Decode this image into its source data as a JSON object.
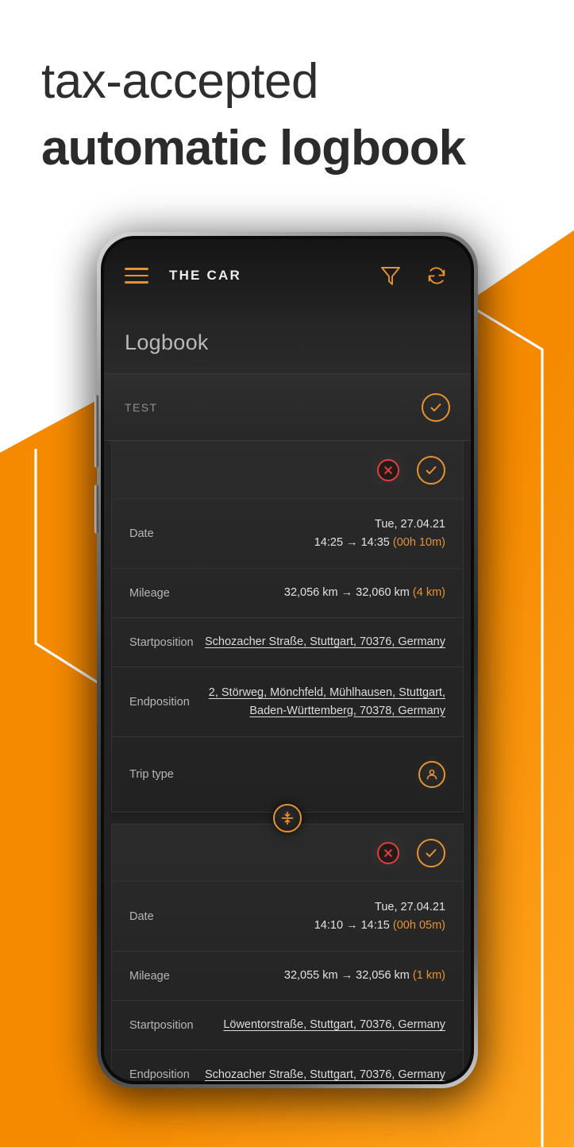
{
  "headline": {
    "line1": "tax-accepted",
    "line2": "automatic logbook"
  },
  "colors": {
    "accent": "#F08A00",
    "accent_ui": "#E8922F",
    "danger": "#E03B3B",
    "screen_bg": "#1F1F1F"
  },
  "app": {
    "appbar": {
      "menu_icon": "hamburger-menu-icon",
      "title": "THE CAR",
      "filter_icon": "filter-funnel-icon",
      "refresh_icon": "refresh-sync-icon"
    },
    "page_title": "Logbook",
    "group": {
      "label": "TEST",
      "accept_icon": "check-circle-icon"
    },
    "labels": {
      "date": "Date",
      "mileage": "Mileage",
      "startposition": "Startposition",
      "endposition": "Endposition",
      "trip_type": "Trip type"
    },
    "merge_icon": "merge-trips-icon",
    "trips": [
      {
        "reject_icon": "reject-circle-icon",
        "accept_icon": "check-circle-icon",
        "date_day": "Tue, 27.04.21",
        "date_times": "14:25 → 14:35",
        "date_duration": "(00h 10m)",
        "mileage_range": "32,056 km → 32,060 km",
        "mileage_delta": "(4 km)",
        "startposition": "Schozacher Straße, Stuttgart, 70376, Germany",
        "endposition_line1": "2, Störweg, Mönchfeld, Mühlhausen, Stuttgart,",
        "endposition_line2": "Baden-Württemberg, 70378, Germany",
        "trip_type_icon": "person-circle-icon"
      },
      {
        "reject_icon": "reject-circle-icon",
        "accept_icon": "check-circle-icon",
        "date_day": "Tue, 27.04.21",
        "date_times": "14:10 → 14:15",
        "date_duration": "(00h 05m)",
        "mileage_range": "32,055 km → 32,056 km",
        "mileage_delta": "(1 km)",
        "startposition": "Löwentorstraße, Stuttgart, 70376, Germany",
        "endposition_line1": "Schozacher Straße, Stuttgart, 70376, Germany",
        "endposition_line2": ""
      }
    ]
  }
}
